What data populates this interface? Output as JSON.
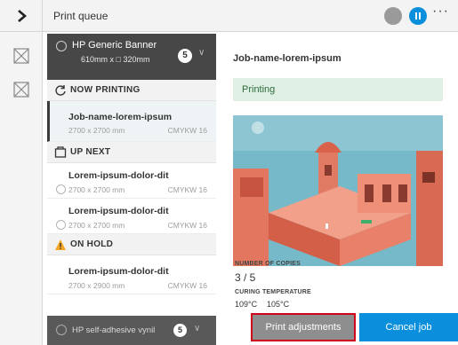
{
  "topbar": {
    "title": "Print queue",
    "icons": [
      "chevron-right-icon",
      "globe-icon",
      "pause-icon",
      "more-icon"
    ],
    "more": "···"
  },
  "rail": {
    "icons": [
      "media-off-icon",
      "media-off-icon"
    ]
  },
  "media": {
    "name": "HP Generic Banner",
    "size_text": "610mm x □ 320mm",
    "count": "5"
  },
  "sections": {
    "now_printing": "NOW PRINTING",
    "up_next": "UP NEXT",
    "on_hold": "ON HOLD"
  },
  "jobs": {
    "printing": {
      "name": "Job-name-lorem-ipsum",
      "dims": "2700 x 2700 mm",
      "color": "CMYKW 16"
    },
    "next1": {
      "name": "Lorem-ipsum-dolor-dit",
      "dims": "2700 x 2700 mm",
      "color": "CMYKW 16"
    },
    "next2": {
      "name": "Lorem-ipsum-dolor-dit",
      "dims": "2700 x 2700 mm",
      "color": "CMYKW 16"
    },
    "hold1": {
      "name": "Lorem-ipsum-dolor-dit",
      "dims": "2700 x 2900 mm",
      "color": "CMYKW 16"
    }
  },
  "bottom_media": {
    "name": "HP self-adhesive vynil",
    "count": "5"
  },
  "details": {
    "title": "Job-name-lorem-ipsum",
    "status": "Printing",
    "copies_label": "NUMBER OF COPIES",
    "copies_value": "3 / 5",
    "curing_label": "CURING TEMPERATURE",
    "temp1": "109°C",
    "temp2": "105°C"
  },
  "buttons": {
    "adjust": "Print adjustments",
    "cancel": "Cancel job"
  },
  "colors": {
    "accent": "#0a8fdc",
    "status_bg": "#e1f0e4",
    "highlight": "#d0021b",
    "hold_icon": "#f5a623"
  }
}
